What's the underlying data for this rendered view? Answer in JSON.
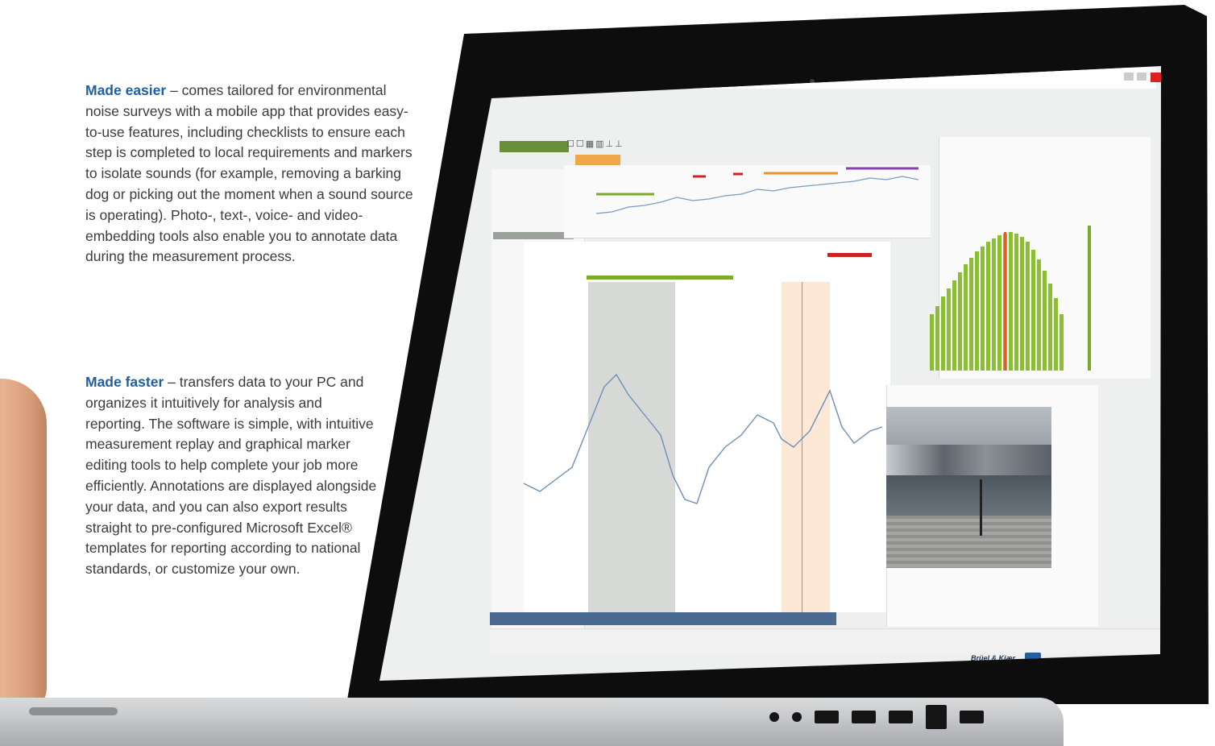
{
  "marketing": {
    "block1": {
      "lead": "Made easier",
      "body": " – comes tailored for environmental noise surveys with a mobile app that provides easy-to-use features, including checklists to ensure each step is completed to local requirements and markers to isolate sounds (for example, removing a barking dog or picking out the moment when a sound source is operating). Photo-, text-, voice- and video-embedding tools also enable you to annotate data during the measurement process."
    },
    "block2": {
      "lead": "Made faster",
      "body": " – transfers data to your PC and organizes it intuitively for analysis and reporting. The software is simple, with intuitive measurement replay and graphical marker editing tools to help complete your job more efficiently. Annotations are displayed alongside your data, and you can also export results straight to pre-configured Microsoft Excel® templates for reporting according to national standards, or customize your own."
    }
  },
  "app": {
    "brand": "Brüel & Kjær",
    "colors": {
      "accent": "#f0a64a",
      "marker_green": "#7aac2a",
      "marker_red": "#cc2222",
      "trace": "#7a9bc2"
    }
  }
}
